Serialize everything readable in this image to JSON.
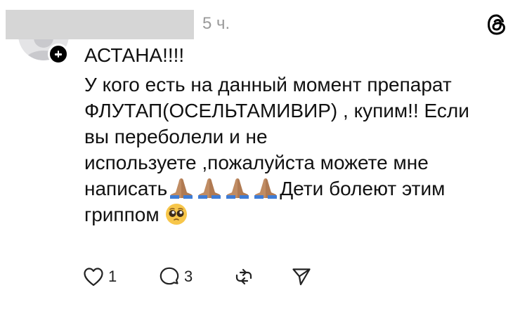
{
  "post": {
    "timestamp": "5 ч.",
    "text_lines": [
      "АСТАНА!!!!",
      "У кого есть на данный момент препарат",
      "ФЛУТАП(ОСЕЛЬТАМИВИР) , купим!! Если",
      "вы переболели и не",
      "используете ,пожалуйста можете мне",
      "написать",
      "Дети болеют этим",
      "гриппом"
    ]
  },
  "actions": {
    "like_count": "1",
    "comment_count": "3"
  },
  "colors": {
    "text": "#111111",
    "muted": "#9a9a9a",
    "redaction": "#d6d6d6"
  },
  "icons": [
    "threads-logo-icon",
    "plus-icon",
    "heart-icon",
    "comment-icon",
    "repost-icon",
    "share-icon",
    "folded-hands-emoji",
    "pleading-face-emoji"
  ]
}
